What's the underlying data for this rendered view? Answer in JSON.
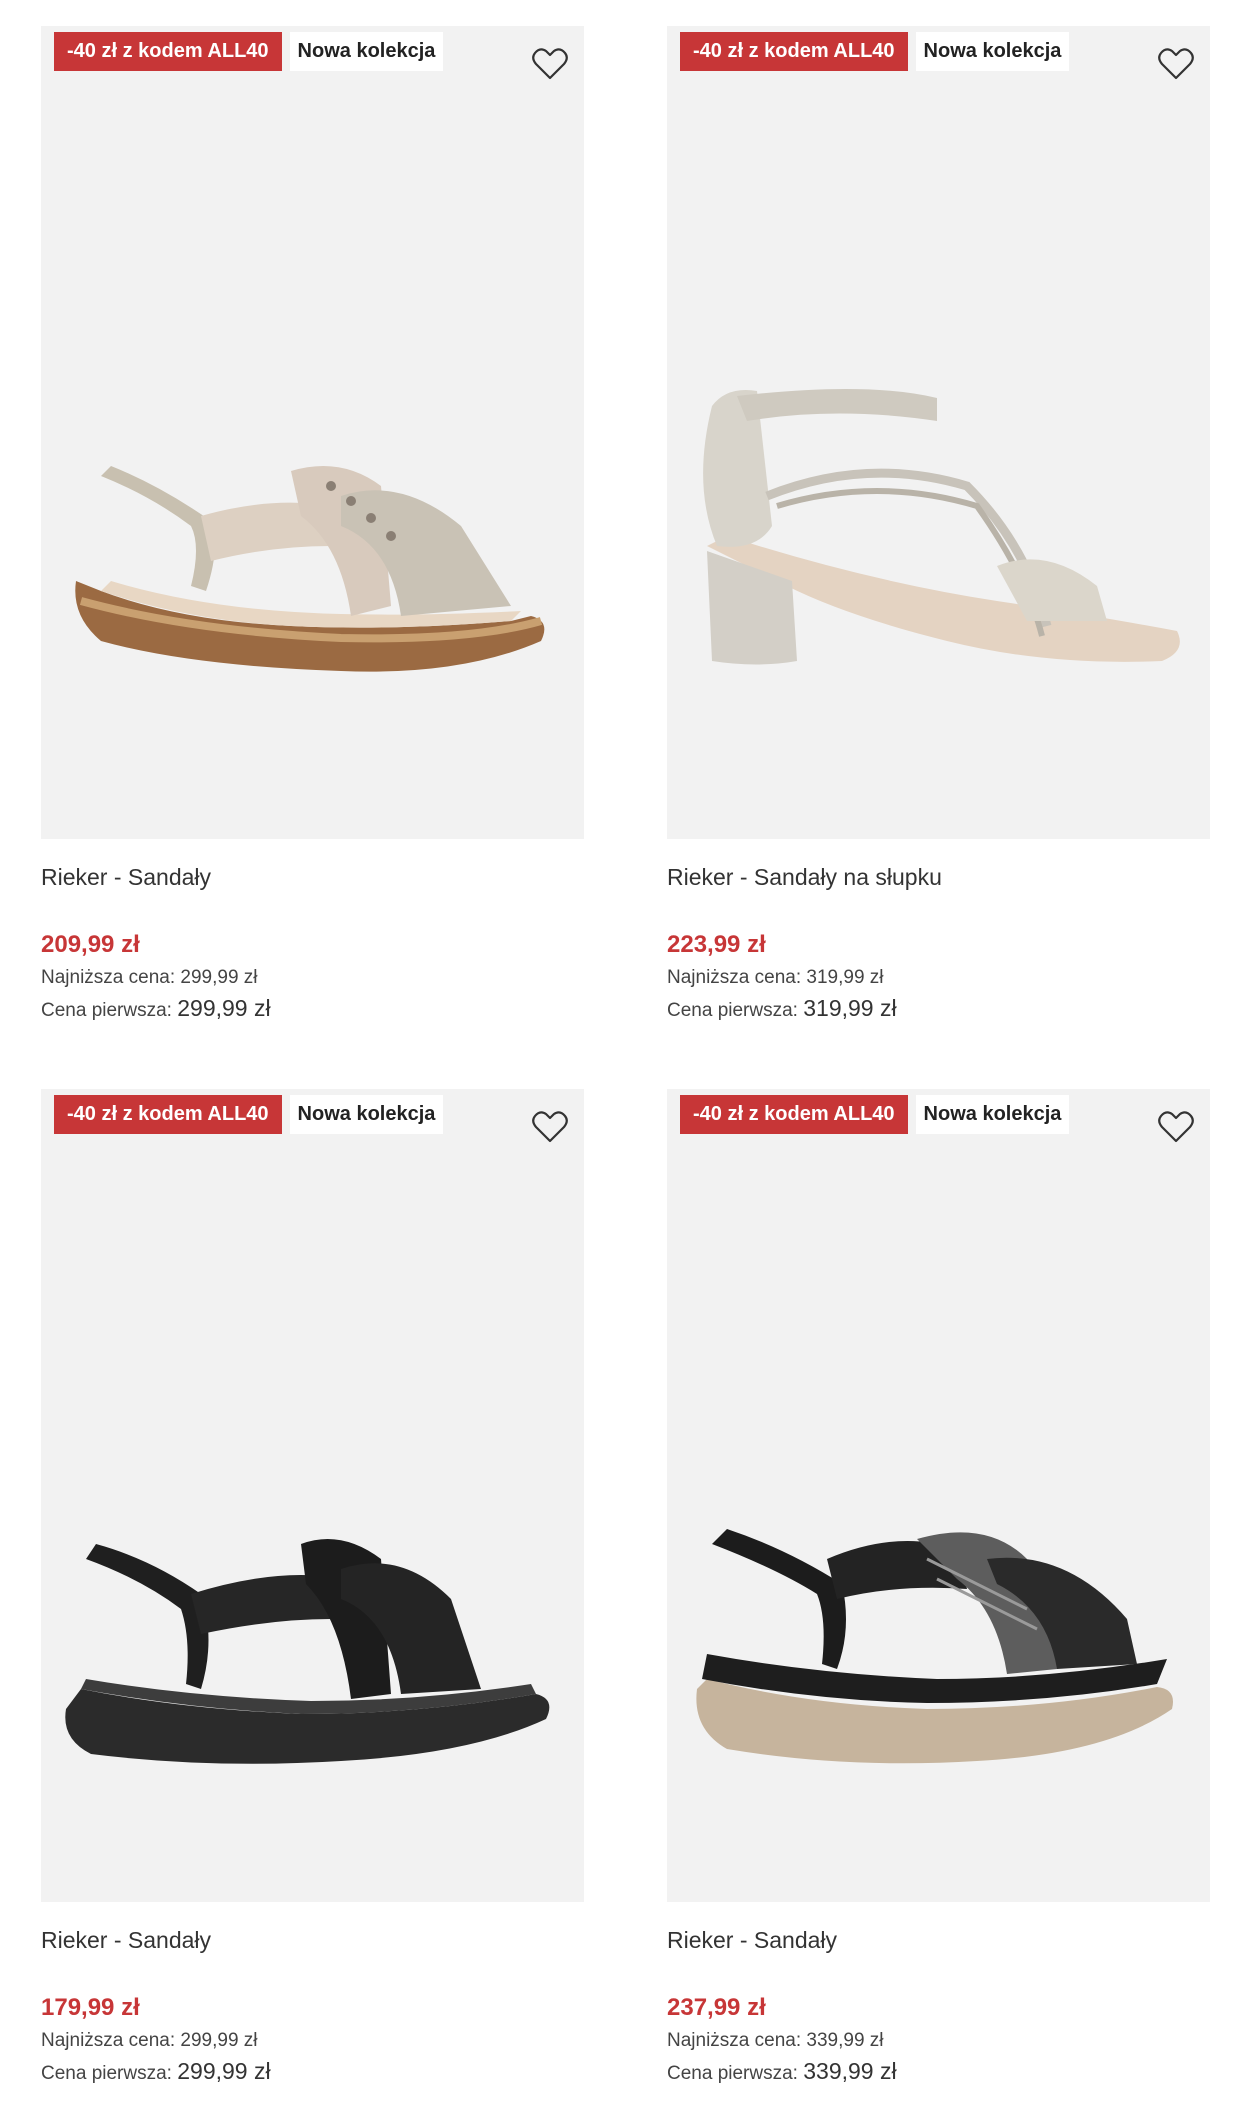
{
  "products": [
    {
      "promo_badge": "-40 zł z kodem ALL40",
      "new_badge": "Nowa kolekcja",
      "title": "Rieker - Sandały",
      "price": "209,99 zł",
      "lowest_label": "Najniższa cena:",
      "lowest_value": "299,99 zł",
      "first_label": "Cena pierwsza:",
      "first_value": "299,99 zł",
      "favorite_icon": "heart-outline-icon"
    },
    {
      "promo_badge": "-40 zł z kodem ALL40",
      "new_badge": "Nowa kolekcja",
      "title": "Rieker - Sandały na słupku",
      "price": "223,99 zł",
      "lowest_label": "Najniższa cena:",
      "lowest_value": "319,99 zł",
      "first_label": "Cena pierwsza:",
      "first_value": "319,99 zł",
      "favorite_icon": "heart-outline-icon"
    },
    {
      "promo_badge": "-40 zł z kodem ALL40",
      "new_badge": "Nowa kolekcja",
      "title": "Rieker - Sandały",
      "price": "179,99 zł",
      "lowest_label": "Najniższa cena:",
      "lowest_value": "299,99 zł",
      "first_label": "Cena pierwsza:",
      "first_value": "299,99 zł",
      "favorite_icon": "heart-outline-icon"
    },
    {
      "promo_badge": "-40 zł z kodem ALL40",
      "new_badge": "Nowa kolekcja",
      "title": "Rieker - Sandały",
      "price": "237,99 zł",
      "lowest_label": "Najniższa cena:",
      "lowest_value": "339,99 zł",
      "first_label": "Cena pierwsza:",
      "first_value": "339,99 zł",
      "favorite_icon": "heart-outline-icon"
    }
  ],
  "colors": {
    "promo": "#c73637",
    "price": "#c73637",
    "image_bg": "#f2f2f2"
  }
}
